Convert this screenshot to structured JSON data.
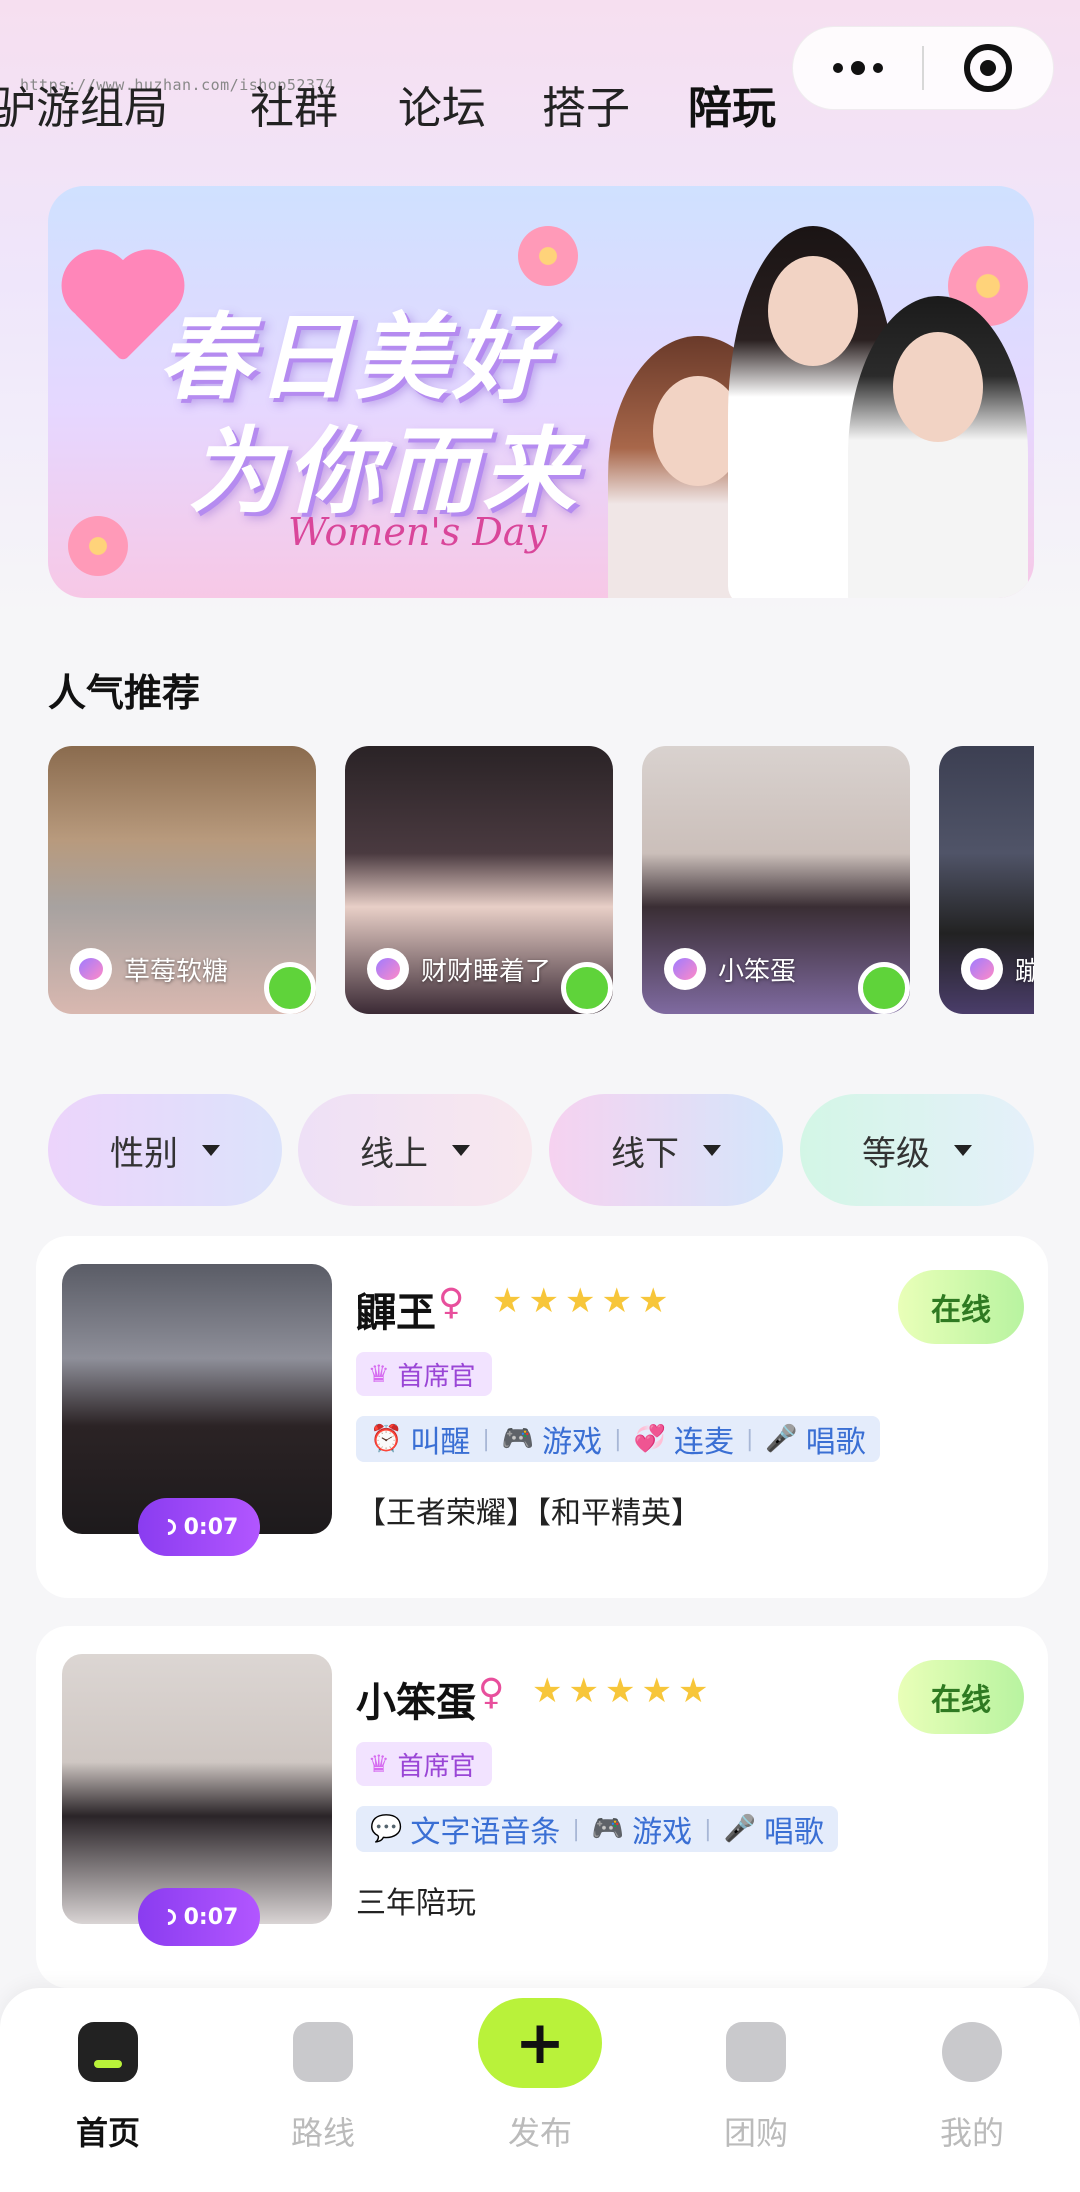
{
  "watermark": "https://www.huzhan.com/ishop52374",
  "tabs": [
    "驴游组局",
    "社群",
    "论坛",
    "搭子",
    "陪玩"
  ],
  "banner": {
    "title_line1": "春日美好",
    "title_line2": "为你而来",
    "subtitle": "Women's Day"
  },
  "popular": {
    "title": "人气推荐",
    "items": [
      {
        "name": "草莓软糖"
      },
      {
        "name": "财财睡着了"
      },
      {
        "name": "小笨蛋"
      },
      {
        "name": "蹦"
      }
    ]
  },
  "filters": [
    "性别",
    "线上",
    "线下",
    "等级"
  ],
  "companions": [
    {
      "name": "鼲玊",
      "gender_icon": "♀",
      "stars": 5,
      "status": "在线",
      "rank": "首席官",
      "skills": [
        {
          "icon": "alarm-icon",
          "glyph": "⏰",
          "label": "叫醒"
        },
        {
          "icon": "gamepad-icon",
          "glyph": "🎮",
          "label": "游戏"
        },
        {
          "icon": "heart-icon",
          "glyph": "💞",
          "label": "连麦"
        },
        {
          "icon": "mic-icon",
          "glyph": "🎤",
          "label": "唱歌"
        }
      ],
      "description": "【王者荣耀】【和平精英】",
      "voice_duration": "0:07"
    },
    {
      "name": "小笨蛋",
      "gender_icon": "♀",
      "stars": 5,
      "status": "在线",
      "rank": "首席官",
      "skills": [
        {
          "icon": "chat-icon",
          "glyph": "💬",
          "label": "文字语音条"
        },
        {
          "icon": "gamepad-icon",
          "glyph": "🎮",
          "label": "游戏"
        },
        {
          "icon": "mic-icon",
          "glyph": "🎤",
          "label": "唱歌"
        }
      ],
      "description": "三年陪玩",
      "voice_duration": "0:07"
    }
  ],
  "bottom_nav": {
    "home": "首页",
    "route": "路线",
    "publish": "发布",
    "group_buy": "团购",
    "mine": "我的"
  },
  "colors": {
    "accent_green": "#b9f23a",
    "online_green": "#5fd33a",
    "skill_blue": "#3a6fd4",
    "rank_purple": "#9a46d6"
  }
}
